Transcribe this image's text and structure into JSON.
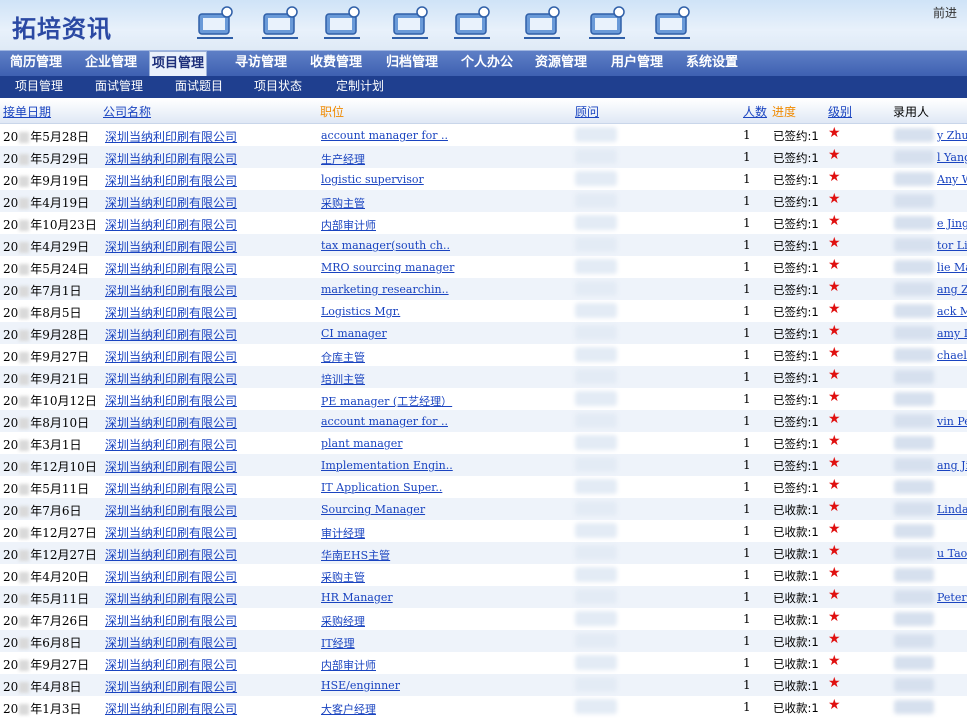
{
  "app": {
    "logo": "拓培资讯",
    "forward_label": "前进"
  },
  "header_icons": [
    "tools-icon-1",
    "tools-icon-2",
    "tools-icon-3",
    "tools-icon-4",
    "tools-icon-5",
    "tools-icon-6",
    "tools-icon-7",
    "tools-icon-8"
  ],
  "main_nav": [
    {
      "label": "简历管理"
    },
    {
      "label": "企业管理"
    },
    {
      "label": "项目管理",
      "active": true
    },
    {
      "label": "寻访管理"
    },
    {
      "label": "收费管理"
    },
    {
      "label": "归档管理"
    },
    {
      "label": "个人办公"
    },
    {
      "label": "资源管理"
    },
    {
      "label": "用户管理"
    },
    {
      "label": "系统设置"
    }
  ],
  "sub_nav": [
    {
      "label": "项目管理"
    },
    {
      "label": "面试管理"
    },
    {
      "label": "面试题目"
    },
    {
      "label": "项目状态"
    },
    {
      "label": "定制计划"
    }
  ],
  "table": {
    "headers": {
      "date": "接单日期",
      "company": "公司名称",
      "position": "职位",
      "consultant": "顾问",
      "count": "人数",
      "progress": "进度",
      "level": "级别",
      "hired": "录用人"
    },
    "rows": [
      {
        "y1": "20",
        "date": "年5月28日",
        "company": "深圳当纳利印刷有限公司",
        "position": "account manager for ..",
        "count": "1",
        "status": "已签约:1",
        "star": "★",
        "hired": "y Zhu"
      },
      {
        "y1": "20",
        "date": "年5月29日",
        "company": "深圳当纳利印刷有限公司",
        "position": "生产经理",
        "count": "1",
        "status": "已签约:1",
        "star": "★",
        "hired": "l Yang"
      },
      {
        "y1": "20",
        "date": "年9月19日",
        "company": "深圳当纳利印刷有限公司",
        "position": "logistic supervisor",
        "count": "1",
        "status": "已签约:1",
        "star": "★",
        "hired": "Any W"
      },
      {
        "y1": "20",
        "date": "年4月19日",
        "company": "深圳当纳利印刷有限公司",
        "position": "采购主管",
        "count": "1",
        "status": "已签约:1",
        "star": "★",
        "hired": ""
      },
      {
        "y1": "20",
        "date": "年10月23日",
        "company": "深圳当纳利印刷有限公司",
        "position": "内部审计师",
        "count": "1",
        "status": "已签约:1",
        "star": "★",
        "hired": "e Jing"
      },
      {
        "y1": "20",
        "date": "年4月29日",
        "company": "深圳当纳利印刷有限公司",
        "position": "tax manager(south ch..",
        "count": "1",
        "status": "已签约:1",
        "star": "★",
        "hired": "tor Liu"
      },
      {
        "y1": "20",
        "date": "年5月24日",
        "company": "深圳当纳利印刷有限公司",
        "position": "MRO sourcing manager",
        "count": "1",
        "status": "已签约:1",
        "star": "★",
        "hired": "lie Ma"
      },
      {
        "y1": "20",
        "date": "年7月1日",
        "company": "深圳当纳利印刷有限公司",
        "position": "marketing researchin..",
        "count": "1",
        "status": "已签约:1",
        "star": "★",
        "hired": "ang Zh"
      },
      {
        "y1": "20",
        "date": "年8月5日",
        "company": "深圳当纳利印刷有限公司",
        "position": "Logistics Mgr.",
        "count": "1",
        "status": "已签约:1",
        "star": "★",
        "hired": "ack M"
      },
      {
        "y1": "20",
        "date": "年9月28日",
        "company": "深圳当纳利印刷有限公司",
        "position": "CI manager",
        "count": "1",
        "status": "已签约:1",
        "star": "★",
        "hired": "amy Li"
      },
      {
        "y1": "20",
        "date": "年9月27日",
        "company": "深圳当纳利印刷有限公司",
        "position": "仓库主管",
        "count": "1",
        "status": "已签约:1",
        "star": "★",
        "hired": "chael F"
      },
      {
        "y1": "20",
        "date": "年9月21日",
        "company": "深圳当纳利印刷有限公司",
        "position": "培训主管",
        "count": "1",
        "status": "已签约:1",
        "star": "★",
        "hired": ""
      },
      {
        "y1": "20",
        "date": "年10月12日",
        "company": "深圳当纳利印刷有限公司",
        "position": "PE manager (工艺经理）",
        "count": "1",
        "status": "已签约:1",
        "star": "★",
        "hired": ""
      },
      {
        "y1": "20",
        "date": "年8月10日",
        "company": "深圳当纳利印刷有限公司",
        "position": "account manager for ..",
        "count": "1",
        "status": "已签约:1",
        "star": "★",
        "hired": "vin Pe"
      },
      {
        "y1": "20",
        "date": "年3月1日",
        "company": "深圳当纳利印刷有限公司",
        "position": "plant manager",
        "count": "1",
        "status": "已签约:1",
        "star": "★",
        "hired": ""
      },
      {
        "y1": "20",
        "date": "年12月10日",
        "company": "深圳当纳利印刷有限公司",
        "position": "Implementation Engin..",
        "count": "1",
        "status": "已签约:1",
        "star": "★",
        "hired": "ang Jin"
      },
      {
        "y1": "20",
        "date": "年5月11日",
        "company": "深圳当纳利印刷有限公司",
        "position": "IT Application Super..",
        "count": "1",
        "status": "已签约:1",
        "star": "★",
        "hired": ""
      },
      {
        "y1": "20",
        "date": "年7月6日",
        "company": "深圳当纳利印刷有限公司",
        "position": "Sourcing Manager",
        "count": "1",
        "status": "已收款:1",
        "star": "★",
        "hired": "Linda Z"
      },
      {
        "y1": "20",
        "date": "年12月27日",
        "company": "深圳当纳利印刷有限公司",
        "position": "审计经理",
        "count": "1",
        "status": "已收款:1",
        "star": "★",
        "hired": ""
      },
      {
        "y1": "20",
        "date": "年12月27日",
        "company": "深圳当纳利印刷有限公司",
        "position": "华南EHS主管",
        "count": "1",
        "status": "已收款:1",
        "star": "★",
        "hired": "u Tao"
      },
      {
        "y1": "20",
        "date": "年4月20日",
        "company": "深圳当纳利印刷有限公司",
        "position": "采购主管",
        "count": "1",
        "status": "已收款:1",
        "star": "★",
        "hired": ""
      },
      {
        "y1": "20",
        "date": "年5月11日",
        "company": "深圳当纳利印刷有限公司",
        "position": "HR Manager",
        "count": "1",
        "status": "已收款:1",
        "star": "★",
        "hired": "Peter M"
      },
      {
        "y1": "20",
        "date": "年7月26日",
        "company": "深圳当纳利印刷有限公司",
        "position": "采购经理",
        "count": "1",
        "status": "已收款:1",
        "star": "★",
        "hired": ""
      },
      {
        "y1": "20",
        "date": "年6月8日",
        "company": "深圳当纳利印刷有限公司",
        "position": "IT经理",
        "count": "1",
        "status": "已收款:1",
        "star": "★",
        "hired": ""
      },
      {
        "y1": "20",
        "date": "年9月27日",
        "company": "深圳当纳利印刷有限公司",
        "position": "内部审计师",
        "count": "1",
        "status": "已收款:1",
        "star": "★",
        "hired": ""
      },
      {
        "y1": "20",
        "date": "年4月8日",
        "company": "深圳当纳利印刷有限公司",
        "position": "HSE/enginner",
        "count": "1",
        "status": "已收款:1",
        "star": "★",
        "hired": ""
      },
      {
        "y1": "20",
        "date": "年1月3日",
        "company": "深圳当纳利印刷有限公司",
        "position": "大客户经理",
        "count": "1",
        "status": "已收款:1",
        "star": "★",
        "hired": ""
      }
    ]
  },
  "colors": {
    "nav_bg": "#3d5fb0",
    "subnav_bg": "#1f3f8f",
    "link": "#1a44c0",
    "star": "#e01010",
    "progress_header": "#f08a00"
  }
}
